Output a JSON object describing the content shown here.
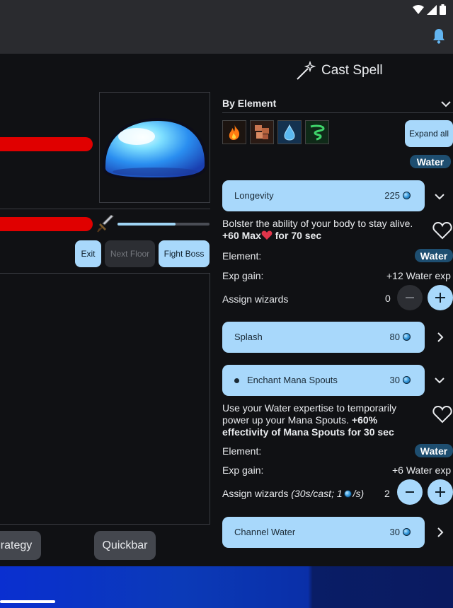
{
  "header": {
    "cast_spell_title": "Cast Spell"
  },
  "battle": {
    "buttons": {
      "exit": "Exit",
      "next_floor": "Next Floor",
      "fight_boss": "Fight Boss"
    },
    "progress": 0.63,
    "bottom_buttons": {
      "strategy": "rategy",
      "quickbar": "Quickbar"
    }
  },
  "spells_panel": {
    "group_label": "By Element",
    "expand_all": "Expand all",
    "element_filter": "Water",
    "elements": [
      "fire-element-icon",
      "earth-element-icon",
      "water-element-icon",
      "wind-element-icon"
    ],
    "spells": [
      {
        "name": "Longevity",
        "cost": "225",
        "expanded": true,
        "desc_plain": "Bolster the ability of your body to stay alive. ",
        "desc_bold_a": "+60 Max",
        "desc_bold_b": " for 70 sec",
        "element_label": "Element:",
        "element_value": "Water",
        "exp_label": "Exp gain:",
        "exp_value": "+12 Water exp",
        "assign_label": "Assign wizards",
        "assigned": "0"
      },
      {
        "name": "Splash",
        "cost": "80",
        "expanded": false
      },
      {
        "name": "Enchant Mana Spouts",
        "cost": "30",
        "expanded": true,
        "desc_plain": "Use your Water expertise to temporarily power up your Mana Spouts. ",
        "desc_bold": "+60% effectivity of Mana Spouts for 30 sec",
        "element_label": "Element:",
        "element_value": "Water",
        "exp_label": "Exp gain:",
        "exp_value": "+6 Water exp",
        "assign_label": "Assign wizards",
        "assign_detail_a": "(30s/cast; 1",
        "assign_detail_b": "/s)",
        "assigned": "2"
      },
      {
        "name": "Channel Water",
        "cost": "30",
        "expanded": false
      }
    ]
  },
  "colors": {
    "accent": "#a8d8fb",
    "hp": "#e00000",
    "water_pill": "#1e4e70",
    "background": "#101114"
  }
}
